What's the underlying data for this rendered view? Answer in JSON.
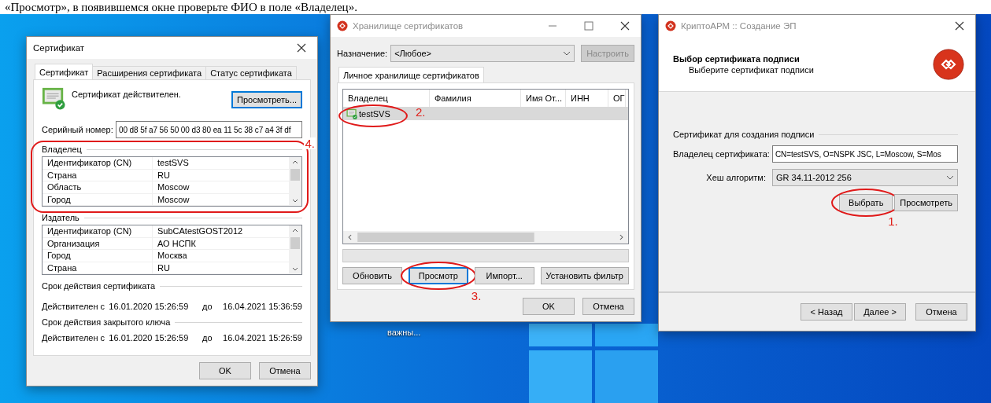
{
  "document_text": "«Просмотр», в появившемся окне проверьте ФИО в поле «Владелец».",
  "desktop_icon": {
    "label": "важны..."
  },
  "certificate_window": {
    "title": "Сертификат",
    "active": true,
    "tabs": [
      {
        "label": "Сертификат",
        "selected": true
      },
      {
        "label": "Расширения сертификата",
        "selected": false
      },
      {
        "label": "Статус сертификата",
        "selected": false
      }
    ],
    "status": "Сертификат действителен.",
    "view_button": {
      "label": "Просмотреть...",
      "focused": true
    },
    "serial_label": "Серийный номер:",
    "serial_value": "00 d8 5f a7 56 50 00 d3 80 ea 11 5c 38 c7 a4 3f df",
    "groups": [
      {
        "title": "Владелец",
        "annotation": "4.",
        "rows": [
          {
            "name": "Идентификатор (CN)",
            "value": "testSVS"
          },
          {
            "name": "Страна",
            "value": "RU"
          },
          {
            "name": "Область",
            "value": "Moscow"
          },
          {
            "name": "Город",
            "value": "Moscow"
          }
        ]
      },
      {
        "title": "Издатель",
        "rows": [
          {
            "name": "Идентификатор (CN)",
            "value": "SubCAtestGOST2012"
          },
          {
            "name": "Организация",
            "value": "АО НСПК"
          },
          {
            "name": "Город",
            "value": "Москва"
          },
          {
            "name": "Страна",
            "value": "RU"
          }
        ]
      }
    ],
    "periods": [
      {
        "title": "Срок действия сертификата",
        "from_label": "Действителен с",
        "from": "16.01.2020 15:26:59",
        "to_label": "до",
        "to": "16.04.2021 15:36:59"
      },
      {
        "title": "Срок действия закрытого ключа",
        "from_label": "Действителен с",
        "from": "16.01.2020 15:26:59",
        "to_label": "до",
        "to": "16.04.2021 15:26:59"
      }
    ],
    "buttons": [
      {
        "label": "OK",
        "focused": false
      },
      {
        "label": "Отмена",
        "focused": false
      }
    ]
  },
  "store_window": {
    "title": "Хранилище сертификатов",
    "active": false,
    "purpose_label": "Назначение:",
    "purpose_value": "<Любое>",
    "configure_button": {
      "label": "Настроить",
      "disabled": true
    },
    "tabs": [
      {
        "label": "Личное хранилище сертификатов",
        "selected": true
      }
    ],
    "columns": [
      "Владелец",
      "Фамилия",
      "Имя От...",
      "ИНН",
      "ОГ"
    ],
    "rows": [
      {
        "owner": "testSVS",
        "selected": true,
        "annotation": "2."
      }
    ],
    "buttons": [
      {
        "label": "Обновить",
        "focused": false
      },
      {
        "label": "Просмотр",
        "focused": true,
        "annotation": "3."
      },
      {
        "label": "Импорт...",
        "focused": false
      },
      {
        "label": "Установить фильтр",
        "focused": false
      }
    ],
    "dialog_buttons": [
      {
        "label": "OK",
        "focused": false
      },
      {
        "label": "Отмена",
        "focused": false
      }
    ]
  },
  "wizard_window": {
    "title": "КриптоАРМ :: Создание ЭП",
    "active": false,
    "header_title": "Выбор сертификата подписи",
    "header_subtitle": "Выберите сертификат подписи",
    "group_title": "Сертификат для создания подписи",
    "owner_label": "Владелец сертификата:",
    "owner_value": "CN=testSVS, O=NSPK JSC, L=Moscow, S=Mos",
    "hash_label": "Хеш алгоритм:",
    "hash_value": "GR 34.11-2012 256",
    "buttons": [
      {
        "label": "Выбрать",
        "focused": false,
        "annotation": "1."
      },
      {
        "label": "Просмотреть",
        "focused": false
      }
    ],
    "nav_buttons": [
      {
        "label": "< Назад",
        "focused": false
      },
      {
        "label": "Далее >",
        "focused": false
      },
      {
        "label": "Отмена",
        "focused": false
      }
    ]
  }
}
